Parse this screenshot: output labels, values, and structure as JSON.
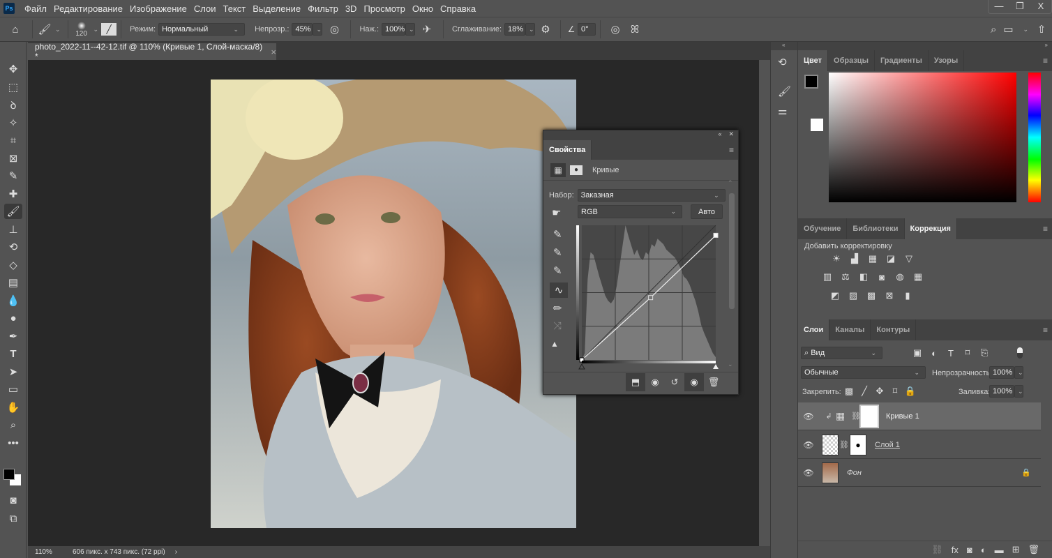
{
  "app": {
    "logo": "Ps"
  },
  "menu": [
    "Файл",
    "Редактирование",
    "Изображение",
    "Слои",
    "Текст",
    "Выделение",
    "Фильтр",
    "3D",
    "Просмотр",
    "Окно",
    "Справка"
  ],
  "window_controls": {
    "minimize": "—",
    "restore": "❐",
    "close": "X"
  },
  "options": {
    "brush_size": "120",
    "mode_label": "Режим:",
    "mode_value": "Нормальный",
    "opacity_label": "Непрозр.:",
    "opacity_value": "45%",
    "flow_label": "Наж.:",
    "flow_value": "100%",
    "smoothing_label": "Сглаживание:",
    "smoothing_value": "18%",
    "angle_value": "0°"
  },
  "document": {
    "tab_title": "photo_2022-11--42-12.tif @ 110% (Кривые 1, Слой-маска/8) *",
    "close": "×"
  },
  "status": {
    "zoom": "110%",
    "info": "606 пикс. x 743 пикс. (72 ppi)",
    "arrow": "›"
  },
  "properties": {
    "tab": "Свойства",
    "type_label": "Кривые",
    "preset_label": "Набор:",
    "preset_value": "Заказная",
    "channel_value": "RGB",
    "auto_button": "Авто",
    "curve_points": [
      [
        0,
        0
      ],
      [
        131,
        118
      ],
      [
        255,
        236
      ]
    ],
    "histogram": [
      0,
      5,
      60,
      80,
      78,
      70,
      62,
      55,
      48,
      44,
      42,
      45,
      55,
      70,
      85,
      100,
      92,
      85,
      78,
      82,
      76,
      74,
      80,
      78,
      86,
      84,
      90,
      88,
      86,
      82,
      80,
      78,
      76,
      72,
      68,
      62,
      60,
      56,
      50,
      44,
      36,
      26,
      20,
      15,
      10,
      5,
      2
    ]
  },
  "color_panel": {
    "tabs": [
      "Цвет",
      "Образцы",
      "Градиенты",
      "Узоры"
    ],
    "active": 0,
    "foreground": "#000000",
    "background": "#ffffff",
    "hue": "#ff0000"
  },
  "adjust_panel": {
    "tabs": [
      "Обучение",
      "Библиотеки",
      "Коррекция"
    ],
    "active": 2,
    "add_label": "Добавить корректировку"
  },
  "layers_panel": {
    "tabs": [
      "Слои",
      "Каналы",
      "Контуры"
    ],
    "active": 0,
    "filter_value": "Вид",
    "blend_value": "Обычные",
    "opacity_label": "Непрозрачность:",
    "opacity_value": "100%",
    "lock_label": "Закрепить:",
    "fill_label": "Заливка:",
    "fill_value": "100%",
    "layers": [
      {
        "name": "Кривые 1",
        "selected": true
      },
      {
        "name": "Слой 1",
        "selected": false
      },
      {
        "name": "Фон",
        "selected": false,
        "locked": true
      }
    ]
  }
}
